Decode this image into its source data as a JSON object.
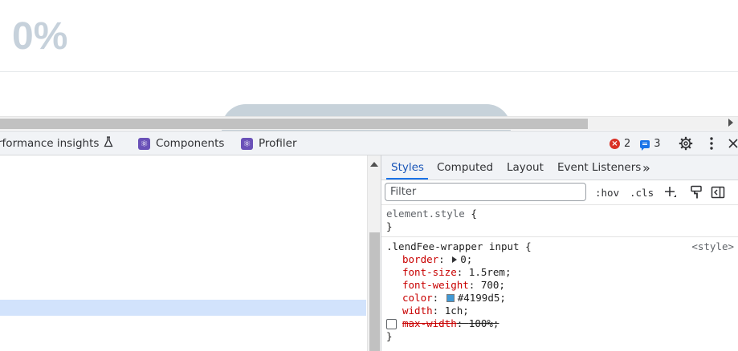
{
  "page": {
    "value_text": "0%"
  },
  "devtools": {
    "tabs": {
      "performance_insights": "rformance insights",
      "components": "Components",
      "profiler": "Profiler"
    },
    "icons": {
      "flask": "flask-icon",
      "react": "react-icon",
      "error": "error-icon",
      "message": "message-icon",
      "gear": "gear-icon",
      "kebab": "kebab-menu-icon",
      "close": "close-icon"
    },
    "error_count": "2",
    "message_count": "3"
  },
  "styles_pane": {
    "tabs": {
      "styles": "Styles",
      "computed": "Computed",
      "layout": "Layout",
      "event_listeners": "Event Listeners",
      "more": "»"
    },
    "filter": {
      "placeholder": "Filter",
      "hov": ":hov",
      "cls": ".cls"
    },
    "element_style": {
      "selector": "element.style",
      "open": "{",
      "close": "}"
    },
    "rule": {
      "selector": ".lendFee-wrapper input",
      "open": "{",
      "close": "}",
      "origin": "<style>",
      "declarations": [
        {
          "name": "border",
          "value": "0;"
        },
        {
          "name": "font-size",
          "value": "1.5rem;"
        },
        {
          "name": "font-weight",
          "value": "700;"
        },
        {
          "name": "color",
          "value": "#4199d5;"
        },
        {
          "name": "width",
          "value": "1ch;"
        },
        {
          "name": "max-width",
          "value": "100%;"
        }
      ]
    }
  },
  "colors": {
    "accent": "#1a73e8",
    "swatch": "#4199d5",
    "error": "#d93025",
    "react_badge": "#6a51b8",
    "selection": "#d2e3fc"
  }
}
